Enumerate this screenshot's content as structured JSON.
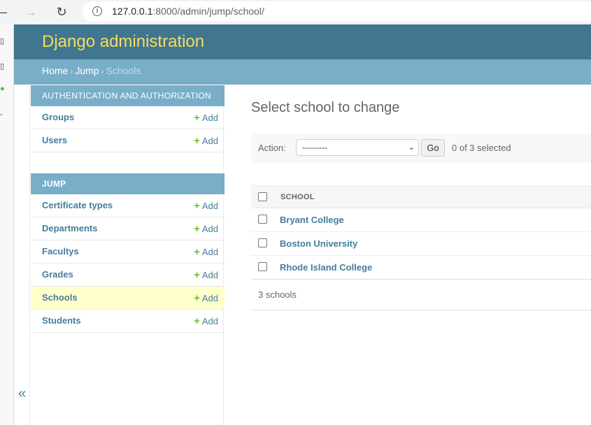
{
  "browser": {
    "url_host": "127.0.0.1",
    "url_rest": ":8000/admin/jump/school/"
  },
  "header": {
    "brand": "Django administration"
  },
  "breadcrumbs": {
    "home": "Home",
    "app": "Jump",
    "current": "Schools",
    "sep": "›"
  },
  "sidebar": {
    "add_label": "Add",
    "modules": [
      {
        "caption": "AUTHENTICATION AND AUTHORIZATION",
        "items": [
          "Groups",
          "Users"
        ]
      },
      {
        "caption": "JUMP",
        "items": [
          "Certificate types",
          "Departments",
          "Facultys",
          "Grades",
          "Schools",
          "Students"
        ],
        "current": "Schools"
      }
    ],
    "collapse_glyph": "«"
  },
  "content": {
    "title": "Select school to change",
    "action_label": "Action:",
    "action_value": "---------",
    "go_label": "Go",
    "selected_count": "0 of 3 selected",
    "column_header": "SCHOOL",
    "rows": [
      "Bryant College",
      "Boston University",
      "Rhode Island College"
    ],
    "paginator": "3 schools"
  },
  "colors": {
    "header": "#417690",
    "brand": "#f5dd5d",
    "breadcrumbs": "#79aec8",
    "link": "#447e9b",
    "add": "#70bf2b",
    "current_row": "#ffffcc"
  }
}
